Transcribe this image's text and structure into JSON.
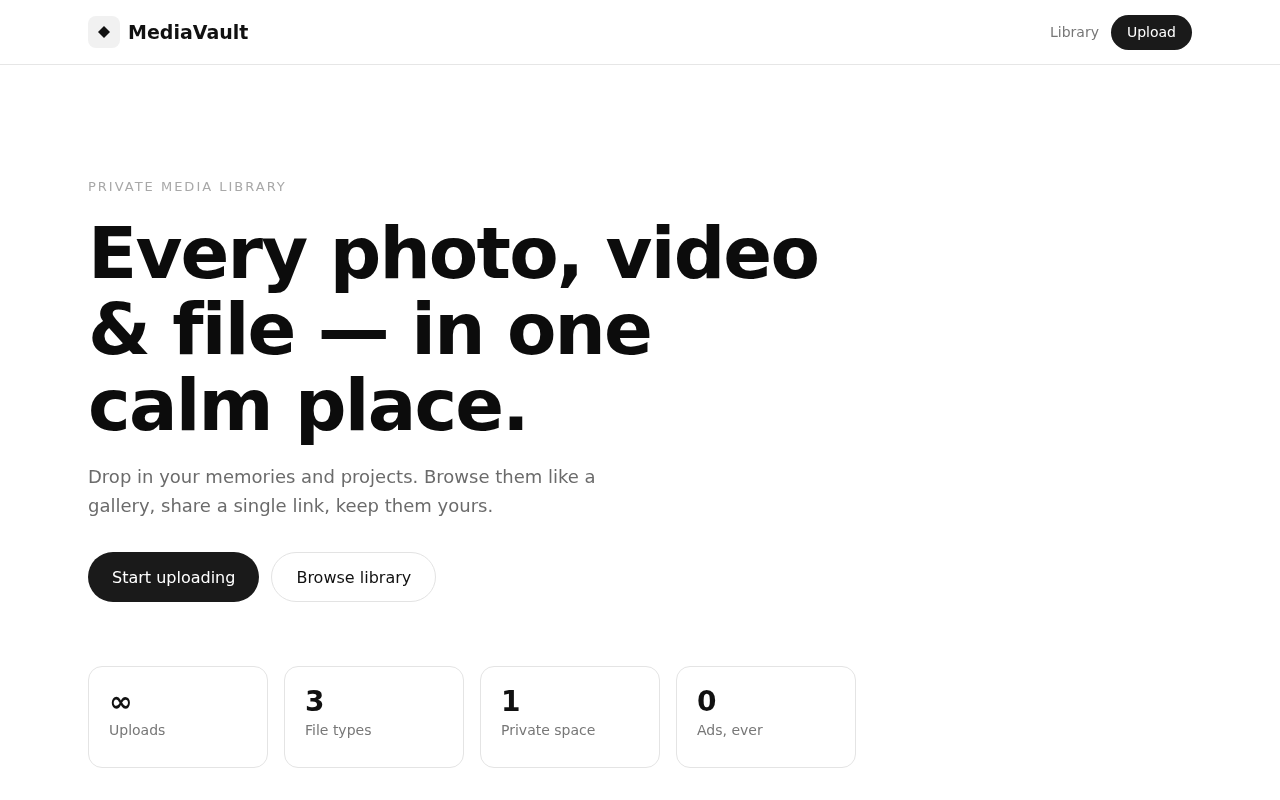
{
  "header": {
    "brand": "MediaVault",
    "nav": [
      {
        "label": "Library",
        "kind": "link"
      },
      {
        "label": "Upload",
        "kind": "button"
      }
    ]
  },
  "hero": {
    "eyebrow": "PRIVATE MEDIA LIBRARY",
    "title": "Every photo, video & file — in one calm place.",
    "subtitle": "Drop in your memories and projects. Browse them like a gallery, share a single link, keep them yours.",
    "actions": [
      {
        "label": "Start uploading",
        "kind": "primary"
      },
      {
        "label": "Browse library",
        "kind": "secondary"
      }
    ]
  },
  "stats": [
    {
      "value": "∞",
      "label": "Uploads"
    },
    {
      "value": "3",
      "label": "File types"
    },
    {
      "value": "1",
      "label": "Private space"
    },
    {
      "value": "0",
      "label": "Ads, ever"
    }
  ]
}
